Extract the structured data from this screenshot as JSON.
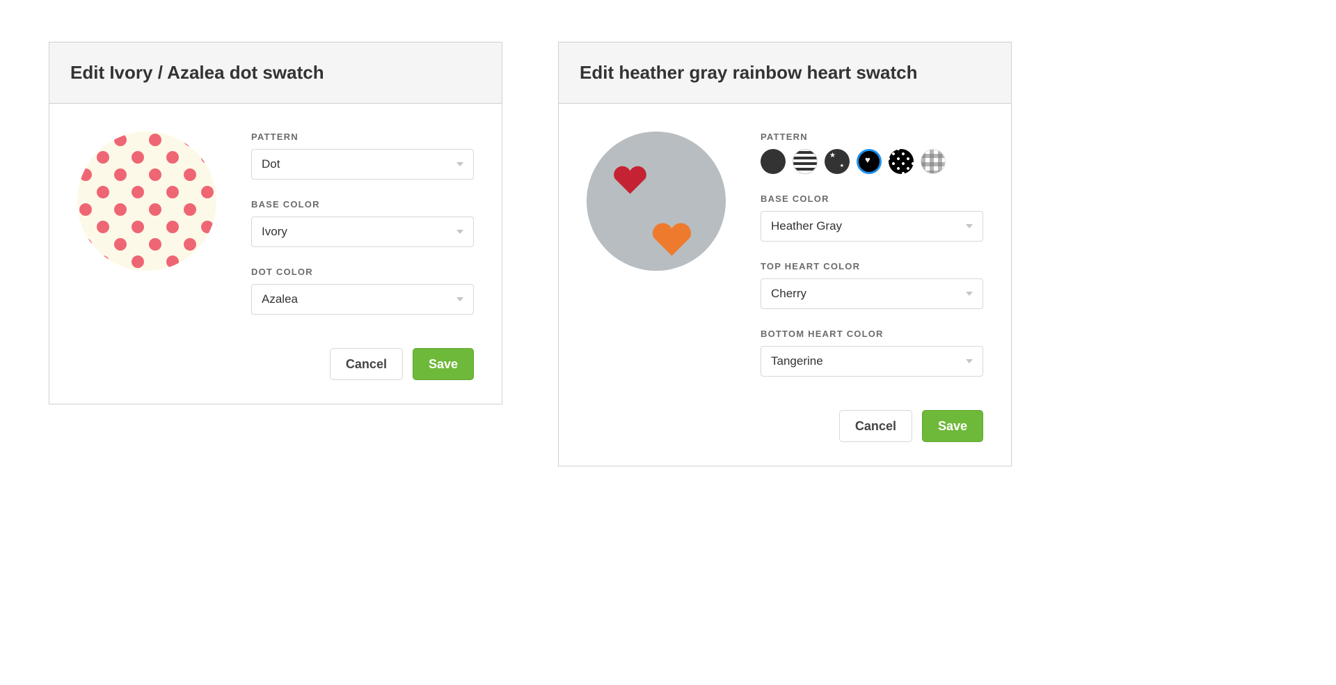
{
  "left_panel": {
    "title": "Edit Ivory / Azalea dot swatch",
    "preview": {
      "base_color": "#fdf9e8",
      "dot_color": "#ee6674"
    },
    "fields": {
      "pattern_label": "PATTERN",
      "pattern_value": "Dot",
      "base_color_label": "BASE COLOR",
      "base_color_value": "Ivory",
      "dot_color_label": "DOT COLOR",
      "dot_color_value": "Azalea"
    },
    "cancel_label": "Cancel",
    "save_label": "Save"
  },
  "right_panel": {
    "title": "Edit heather gray rainbow heart swatch",
    "preview": {
      "base_color": "#b7bdc0",
      "top_heart_color": "#c52333",
      "bottom_heart_color": "#ee7a2e"
    },
    "fields": {
      "pattern_label": "PATTERN",
      "pattern_swatches": [
        {
          "name": "solid",
          "selected": false
        },
        {
          "name": "stripes",
          "selected": false
        },
        {
          "name": "stars",
          "selected": false
        },
        {
          "name": "hearts",
          "selected": true
        },
        {
          "name": "dots",
          "selected": false
        },
        {
          "name": "gingham",
          "selected": false
        }
      ],
      "base_color_label": "BASE COLOR",
      "base_color_value": "Heather Gray",
      "top_heart_label": "TOP HEART COLOR",
      "top_heart_value": "Cherry",
      "bottom_heart_label": "BOTTOM HEART COLOR",
      "bottom_heart_value": "Tangerine"
    },
    "cancel_label": "Cancel",
    "save_label": "Save"
  }
}
